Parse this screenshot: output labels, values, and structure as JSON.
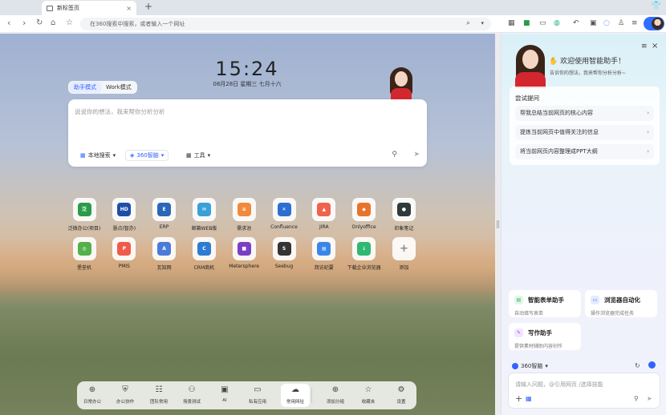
{
  "browser": {
    "tab_title": "新标签页",
    "tab_close": "×",
    "new_tab": "+",
    "address_placeholder": "在360搜索中搜索，或者输入一个网址"
  },
  "page": {
    "time": "15:24",
    "date": "08月28日 星期三 七月十六",
    "mode_tabs": [
      "助手模式",
      "Work模式"
    ],
    "ask_placeholder": "说说你的想法，我来帮你分析分析",
    "ask_buttons": {
      "local_search": "本地搜索",
      "ai_360": "360智脑",
      "tools": "工具"
    },
    "apps_row1": [
      {
        "label": "泛微办公(项目)",
        "icon": "weaver-icon",
        "glyph": "泛",
        "color": "#2b9b4a"
      },
      {
        "label": "慧点(智办)",
        "icon": "huidian-icon",
        "glyph": "HD",
        "color": "#1d4fa8"
      },
      {
        "label": "ERP",
        "icon": "erp-icon",
        "glyph": "E",
        "color": "#2c66b8"
      },
      {
        "label": "邮箱WEB版",
        "icon": "mail-icon",
        "glyph": "✉",
        "color": "#3aa0d8"
      },
      {
        "label": "需求池",
        "icon": "requirement-pool-icon",
        "glyph": "≡",
        "color": "#f08a3c"
      },
      {
        "label": "Confluence",
        "icon": "confluence-icon",
        "glyph": "✕",
        "color": "#2c6fd1"
      },
      {
        "label": "JIRA",
        "icon": "jira-icon",
        "glyph": "▲",
        "color": "#f0624b"
      },
      {
        "label": "Onlyoffice",
        "icon": "onlyoffice-icon",
        "glyph": "◆",
        "color": "#e8732a"
      },
      {
        "label": "印象笔记",
        "icon": "evernote-icon",
        "glyph": "●",
        "color": "#2f3a3a"
      }
    ],
    "apps_row2": [
      {
        "label": "堡垒机",
        "icon": "bastion-icon",
        "glyph": "◎",
        "color": "#53b04a"
      },
      {
        "label": "PMIS",
        "icon": "pmis-icon",
        "glyph": "P",
        "color": "#f05a4b"
      },
      {
        "label": "瓦知网",
        "icon": "wazhi-icon",
        "glyph": "A",
        "color": "#4a7bd8"
      },
      {
        "label": "CRM商机",
        "icon": "crm-icon",
        "glyph": "C",
        "color": "#2d7bd2"
      },
      {
        "label": "Metersphere",
        "icon": "metersphere-icon",
        "glyph": "■",
        "color": "#7b3fc6"
      },
      {
        "label": "Seebug",
        "icon": "seebug-icon",
        "glyph": "S",
        "color": "#333333"
      },
      {
        "label": "拜访纪要",
        "icon": "visit-notes-icon",
        "glyph": "▤",
        "color": "#3a86e8"
      },
      {
        "label": "下载企业浏览器",
        "icon": "download-browser-icon",
        "glyph": "↓",
        "color": "#2eb872"
      },
      {
        "label": "添加",
        "icon": "add-app-icon",
        "glyph": "+",
        "color": "#888888"
      }
    ],
    "dock": [
      {
        "label": "日常办公",
        "icon": "daily-office-icon",
        "glyph": "⊕"
      },
      {
        "label": "办公协作",
        "icon": "collaboration-icon",
        "glyph": "⛨"
      },
      {
        "label": "团队常用",
        "icon": "team-icon",
        "glyph": "☷"
      },
      {
        "label": "场景测试",
        "icon": "scene-test-icon",
        "glyph": "⚇"
      },
      {
        "label": "AI",
        "icon": "ai-icon",
        "glyph": "▣"
      },
      {
        "label": "私有应用",
        "icon": "private-apps-icon",
        "glyph": "▭"
      },
      {
        "label": "常用网址",
        "icon": "common-sites-icon",
        "glyph": "☁"
      },
      {
        "label": "添加分组",
        "icon": "add-group-icon",
        "glyph": "⊕"
      },
      {
        "label": "收藏夹",
        "icon": "favorites-icon",
        "glyph": "☆"
      },
      {
        "label": "设置",
        "icon": "settings-icon",
        "glyph": "⚙"
      }
    ]
  },
  "assistant": {
    "welcome": "欢迎使用智能助手！",
    "subtitle": "告诉你的想法，我来帮你分析分析~",
    "try_title": "尝试提问",
    "suggestions": [
      "帮我总结当前网页的核心内容",
      "提炼当前网页中值得关注的信息",
      "将当前网页内容整理成PPT大纲"
    ],
    "cards": [
      {
        "title": "智能表单助手",
        "desc": "自动填写表单"
      },
      {
        "title": "浏览器自动化",
        "desc": "操作浏览器完成任务"
      },
      {
        "title": "写作助手",
        "desc": "提供素材辅助内容创作"
      }
    ],
    "model": "360智脑",
    "chat_placeholder": "请输入问题，@引用网页 /选择技能"
  },
  "colors": {
    "accent": "#3263ff",
    "mascot_red": "#d4262e"
  }
}
